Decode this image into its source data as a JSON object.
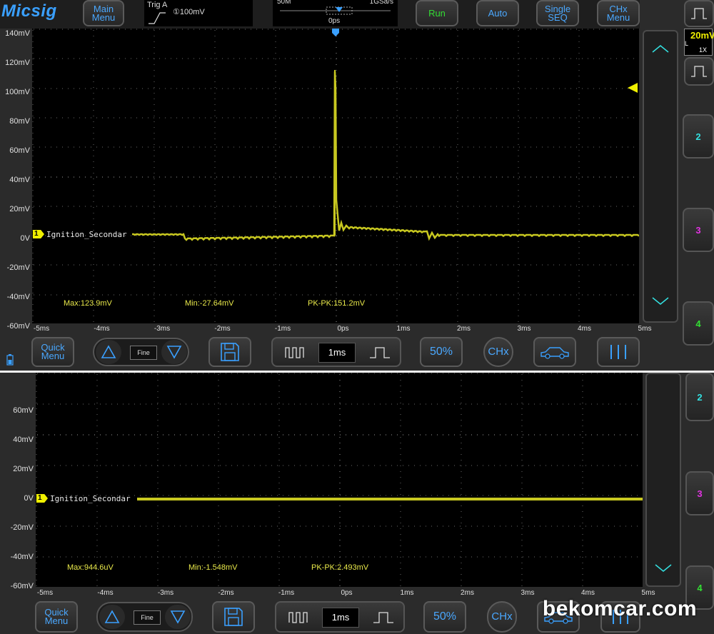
{
  "brand": "Micsig",
  "toolbar": {
    "main_menu": "Main\nMenu",
    "run": "Run",
    "auto": "Auto",
    "single_seq": "Single\nSEQ",
    "chx_menu": "CHx\nMenu"
  },
  "trigger": {
    "label": "Trig A",
    "level": "①100mV"
  },
  "timebase_top": {
    "memory": "50M",
    "rate": "1GSa/s",
    "position": "0ps"
  },
  "probe": {
    "scale": "20mV",
    "coupling": "L",
    "attenuation": "1X"
  },
  "channels": {
    "ch2": "2",
    "ch3": "3",
    "ch4": "4"
  },
  "upper": {
    "y_labels": [
      "140mV",
      "120mV",
      "100mV",
      "80mV",
      "60mV",
      "40mV",
      "20mV",
      "0V",
      "-20mV",
      "-40mV",
      "-60mV"
    ],
    "x_labels": [
      "-5ms",
      "-4ms",
      "-3ms",
      "-2ms",
      "-1ms",
      "0ps",
      "1ms",
      "2ms",
      "3ms",
      "4ms",
      "5ms"
    ],
    "channel_name": "Ignition_Secondar",
    "channel_number": "1",
    "max": "Max:123.9mV",
    "min": "Min:-27.64mV",
    "pkpk": "PK-PK:151.2mV",
    "bottom": {
      "quick_menu": "Quick\nMenu",
      "fine": "Fine",
      "timebase": "1ms",
      "fifty": "50%",
      "chx": "CHx"
    }
  },
  "lower": {
    "y_labels": [
      "60mV",
      "40mV",
      "20mV",
      "0V",
      "-20mV",
      "-40mV",
      "-60mV"
    ],
    "x_labels": [
      "-5ms",
      "-4ms",
      "-3ms",
      "-2ms",
      "-1ms",
      "0ps",
      "1ms",
      "2ms",
      "3ms",
      "4ms",
      "5ms"
    ],
    "channel_name": "Ignition_Secondar",
    "channel_number": "1",
    "max": "Max:944.6uV",
    "min": "Min:-1.548mV",
    "pkpk": "PK-PK:2.493mV",
    "bottom": {
      "quick_menu": "Quick\nMenu",
      "fine": "Fine",
      "timebase": "1ms",
      "fifty": "50%",
      "chx": "CHx"
    }
  },
  "watermark": "bekomcar.com",
  "colors": {
    "trace": "#c8c820",
    "accent": "#4aa8ff",
    "run": "#33dd33",
    "ch2": "#33e0e0",
    "ch3": "#e033e0",
    "ch4": "#33e033"
  }
}
